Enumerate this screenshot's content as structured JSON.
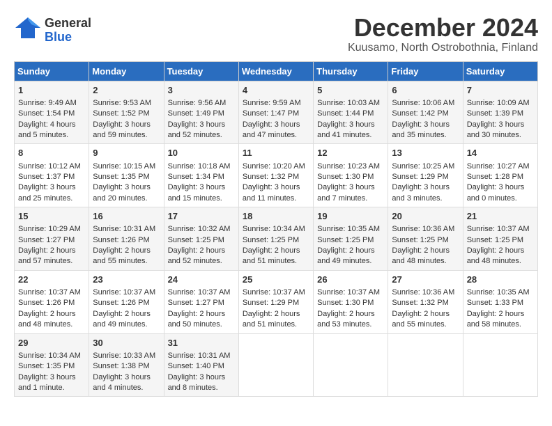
{
  "logo": {
    "general": "General",
    "blue": "Blue"
  },
  "title": "December 2024",
  "subtitle": "Kuusamo, North Ostrobothnia, Finland",
  "days_of_week": [
    "Sunday",
    "Monday",
    "Tuesday",
    "Wednesday",
    "Thursday",
    "Friday",
    "Saturday"
  ],
  "weeks": [
    [
      {
        "day": "1",
        "info": "Sunrise: 9:49 AM\nSunset: 1:54 PM\nDaylight: 4 hours\nand 5 minutes."
      },
      {
        "day": "2",
        "info": "Sunrise: 9:53 AM\nSunset: 1:52 PM\nDaylight: 3 hours\nand 59 minutes."
      },
      {
        "day": "3",
        "info": "Sunrise: 9:56 AM\nSunset: 1:49 PM\nDaylight: 3 hours\nand 52 minutes."
      },
      {
        "day": "4",
        "info": "Sunrise: 9:59 AM\nSunset: 1:47 PM\nDaylight: 3 hours\nand 47 minutes."
      },
      {
        "day": "5",
        "info": "Sunrise: 10:03 AM\nSunset: 1:44 PM\nDaylight: 3 hours\nand 41 minutes."
      },
      {
        "day": "6",
        "info": "Sunrise: 10:06 AM\nSunset: 1:42 PM\nDaylight: 3 hours\nand 35 minutes."
      },
      {
        "day": "7",
        "info": "Sunrise: 10:09 AM\nSunset: 1:39 PM\nDaylight: 3 hours\nand 30 minutes."
      }
    ],
    [
      {
        "day": "8",
        "info": "Sunrise: 10:12 AM\nSunset: 1:37 PM\nDaylight: 3 hours\nand 25 minutes."
      },
      {
        "day": "9",
        "info": "Sunrise: 10:15 AM\nSunset: 1:35 PM\nDaylight: 3 hours\nand 20 minutes."
      },
      {
        "day": "10",
        "info": "Sunrise: 10:18 AM\nSunset: 1:34 PM\nDaylight: 3 hours\nand 15 minutes."
      },
      {
        "day": "11",
        "info": "Sunrise: 10:20 AM\nSunset: 1:32 PM\nDaylight: 3 hours\nand 11 minutes."
      },
      {
        "day": "12",
        "info": "Sunrise: 10:23 AM\nSunset: 1:30 PM\nDaylight: 3 hours\nand 7 minutes."
      },
      {
        "day": "13",
        "info": "Sunrise: 10:25 AM\nSunset: 1:29 PM\nDaylight: 3 hours\nand 3 minutes."
      },
      {
        "day": "14",
        "info": "Sunrise: 10:27 AM\nSunset: 1:28 PM\nDaylight: 3 hours\nand 0 minutes."
      }
    ],
    [
      {
        "day": "15",
        "info": "Sunrise: 10:29 AM\nSunset: 1:27 PM\nDaylight: 2 hours\nand 57 minutes."
      },
      {
        "day": "16",
        "info": "Sunrise: 10:31 AM\nSunset: 1:26 PM\nDaylight: 2 hours\nand 55 minutes."
      },
      {
        "day": "17",
        "info": "Sunrise: 10:32 AM\nSunset: 1:25 PM\nDaylight: 2 hours\nand 52 minutes."
      },
      {
        "day": "18",
        "info": "Sunrise: 10:34 AM\nSunset: 1:25 PM\nDaylight: 2 hours\nand 51 minutes."
      },
      {
        "day": "19",
        "info": "Sunrise: 10:35 AM\nSunset: 1:25 PM\nDaylight: 2 hours\nand 49 minutes."
      },
      {
        "day": "20",
        "info": "Sunrise: 10:36 AM\nSunset: 1:25 PM\nDaylight: 2 hours\nand 48 minutes."
      },
      {
        "day": "21",
        "info": "Sunrise: 10:37 AM\nSunset: 1:25 PM\nDaylight: 2 hours\nand 48 minutes."
      }
    ],
    [
      {
        "day": "22",
        "info": "Sunrise: 10:37 AM\nSunset: 1:26 PM\nDaylight: 2 hours\nand 48 minutes."
      },
      {
        "day": "23",
        "info": "Sunrise: 10:37 AM\nSunset: 1:26 PM\nDaylight: 2 hours\nand 49 minutes."
      },
      {
        "day": "24",
        "info": "Sunrise: 10:37 AM\nSunset: 1:27 PM\nDaylight: 2 hours\nand 50 minutes."
      },
      {
        "day": "25",
        "info": "Sunrise: 10:37 AM\nSunset: 1:29 PM\nDaylight: 2 hours\nand 51 minutes."
      },
      {
        "day": "26",
        "info": "Sunrise: 10:37 AM\nSunset: 1:30 PM\nDaylight: 2 hours\nand 53 minutes."
      },
      {
        "day": "27",
        "info": "Sunrise: 10:36 AM\nSunset: 1:32 PM\nDaylight: 2 hours\nand 55 minutes."
      },
      {
        "day": "28",
        "info": "Sunrise: 10:35 AM\nSunset: 1:33 PM\nDaylight: 2 hours\nand 58 minutes."
      }
    ],
    [
      {
        "day": "29",
        "info": "Sunrise: 10:34 AM\nSunset: 1:35 PM\nDaylight: 3 hours\nand 1 minute."
      },
      {
        "day": "30",
        "info": "Sunrise: 10:33 AM\nSunset: 1:38 PM\nDaylight: 3 hours\nand 4 minutes."
      },
      {
        "day": "31",
        "info": "Sunrise: 10:31 AM\nSunset: 1:40 PM\nDaylight: 3 hours\nand 8 minutes."
      },
      {
        "day": "",
        "info": ""
      },
      {
        "day": "",
        "info": ""
      },
      {
        "day": "",
        "info": ""
      },
      {
        "day": "",
        "info": ""
      }
    ]
  ]
}
